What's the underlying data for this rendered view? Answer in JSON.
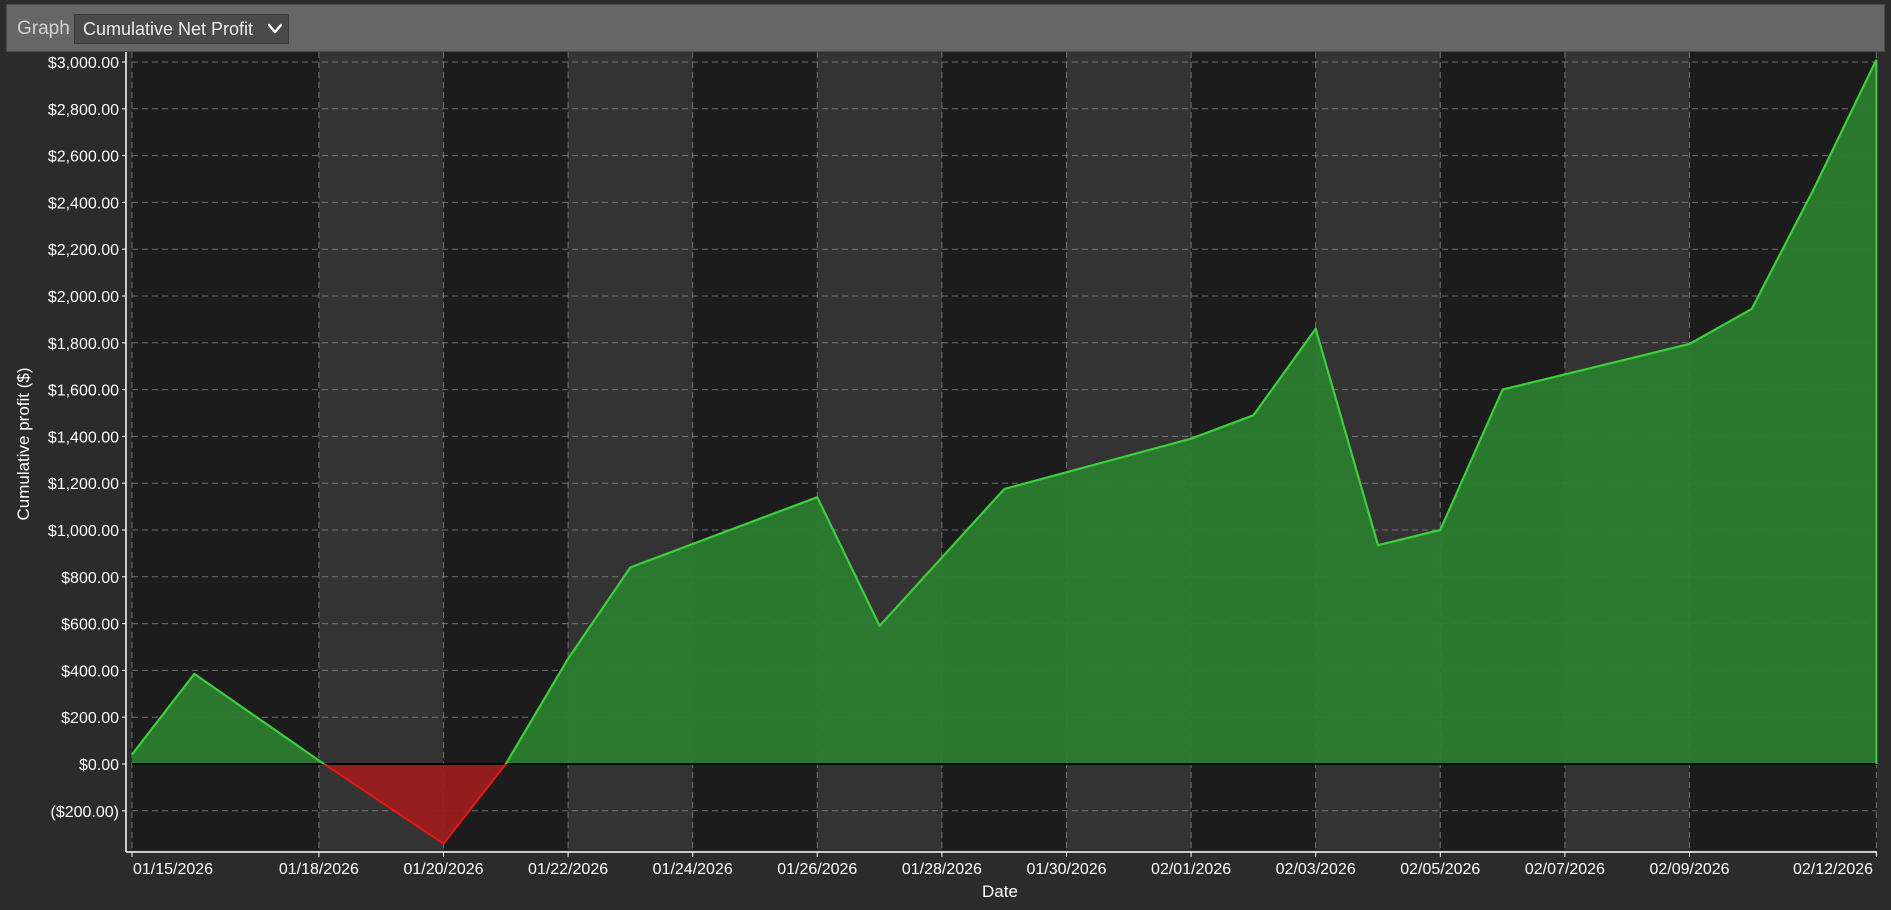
{
  "toolbar": {
    "graph_label": "Graph",
    "metric_selected": "Cumulative Net Profit",
    "dropdown_icon": "chevron-down-icon"
  },
  "colors": {
    "background": "#1c1c1c",
    "band": "#333333",
    "grid": "#8a8a8a",
    "positive_fill": "#2a7d2e",
    "positive_line": "#3ccf3c",
    "negative_fill": "#9b1c1c",
    "negative_line": "#e01818"
  },
  "chart_data": {
    "type": "area",
    "xlabel": "Date",
    "ylabel": "Cumulative profit ($)",
    "ylim": [
      -350,
      3000
    ],
    "xlim": [
      "01/15/2026",
      "02/13/2026"
    ],
    "y_ticks": [
      {
        "value": 3000,
        "label": "$3,000.00"
      },
      {
        "value": 2800,
        "label": "$2,800.00"
      },
      {
        "value": 2600,
        "label": "$2,600.00"
      },
      {
        "value": 2400,
        "label": "$2,400.00"
      },
      {
        "value": 2200,
        "label": "$2,200.00"
      },
      {
        "value": 2000,
        "label": "$2,000.00"
      },
      {
        "value": 1800,
        "label": "$1,800.00"
      },
      {
        "value": 1600,
        "label": "$1,600.00"
      },
      {
        "value": 1400,
        "label": "$1,400.00"
      },
      {
        "value": 1200,
        "label": "$1,200.00"
      },
      {
        "value": 1000,
        "label": "$1,000.00"
      },
      {
        "value": 800,
        "label": "$800.00"
      },
      {
        "value": 600,
        "label": "$600.00"
      },
      {
        "value": 400,
        "label": "$400.00"
      },
      {
        "value": 200,
        "label": "$200.00"
      },
      {
        "value": 0,
        "label": "$0.00"
      },
      {
        "value": -200,
        "label": "($200.00)"
      }
    ],
    "x_ticks": [
      {
        "date": "01/15/2026",
        "label": "01/15/2026"
      },
      {
        "date": "01/18/2026",
        "label": "01/18/2026"
      },
      {
        "date": "01/20/2026",
        "label": "01/20/2026"
      },
      {
        "date": "01/22/2026",
        "label": "01/22/2026"
      },
      {
        "date": "01/24/2026",
        "label": "01/24/2026"
      },
      {
        "date": "01/26/2026",
        "label": "01/26/2026"
      },
      {
        "date": "01/28/2026",
        "label": "01/28/2026"
      },
      {
        "date": "01/30/2026",
        "label": "01/30/2026"
      },
      {
        "date": "02/01/2026",
        "label": "02/01/2026"
      },
      {
        "date": "02/03/2026",
        "label": "02/03/2026"
      },
      {
        "date": "02/05/2026",
        "label": "02/05/2026"
      },
      {
        "date": "02/07/2026",
        "label": "02/07/2026"
      },
      {
        "date": "02/09/2026",
        "label": "02/09/2026"
      },
      {
        "date": "02/12/2026",
        "label": "02/12/2026"
      }
    ],
    "bands": [
      [
        "01/18/2026",
        "01/20/2026"
      ],
      [
        "01/22/2026",
        "01/24/2026"
      ],
      [
        "01/26/2026",
        "01/28/2026"
      ],
      [
        "01/30/2026",
        "02/01/2026"
      ],
      [
        "02/03/2026",
        "02/05/2026"
      ],
      [
        "02/07/2026",
        "02/09/2026"
      ]
    ],
    "series": [
      {
        "points": [
          {
            "x": "01/15/2026",
            "y": 40
          },
          {
            "x": "01/16/2026",
            "y": 385
          },
          {
            "x": "01/18/2026",
            "y": 15
          },
          {
            "x": "01/20/2026",
            "y": -340
          },
          {
            "x": "01/21/2026",
            "y": 0
          },
          {
            "x": "01/22/2026",
            "y": 450
          },
          {
            "x": "01/23/2026",
            "y": 840
          },
          {
            "x": "01/26/2026",
            "y": 1140
          },
          {
            "x": "01/27/2026",
            "y": 590
          },
          {
            "x": "01/29/2026",
            "y": 1175
          },
          {
            "x": "02/01/2026",
            "y": 1390
          },
          {
            "x": "02/02/2026",
            "y": 1490
          },
          {
            "x": "02/03/2026",
            "y": 1860
          },
          {
            "x": "02/04/2026",
            "y": 935
          },
          {
            "x": "02/05/2026",
            "y": 1000
          },
          {
            "x": "02/06/2026",
            "y": 1600
          },
          {
            "x": "02/09/2026",
            "y": 1795
          },
          {
            "x": "02/10/2026",
            "y": 1945
          },
          {
            "x": "02/11/2026",
            "y": 2460
          },
          {
            "x": "02/12/2026",
            "y": 3010
          }
        ]
      }
    ]
  }
}
